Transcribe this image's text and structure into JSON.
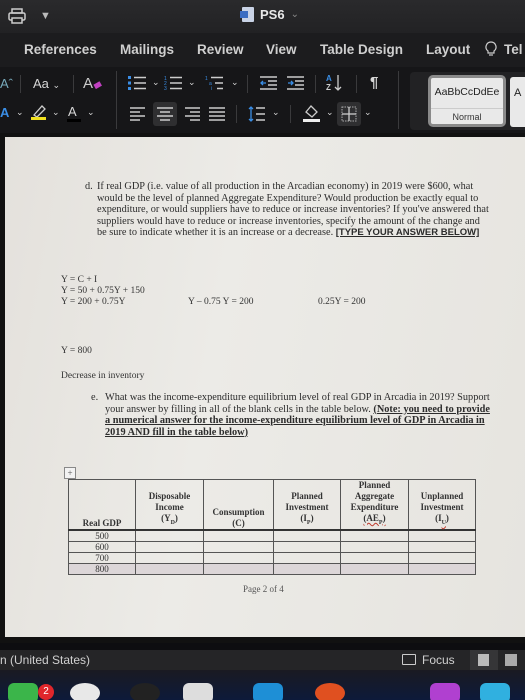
{
  "titlebar": {
    "doc_title": "PS6",
    "icons": [
      "print-icon",
      "customize-quick-access-icon",
      "word-doc-icon",
      "chevron-down-icon"
    ]
  },
  "tabs": [
    {
      "label": "References"
    },
    {
      "label": "Mailings"
    },
    {
      "label": "Review"
    },
    {
      "label": "View"
    },
    {
      "label": "Table Design"
    },
    {
      "label": "Layout"
    },
    {
      "label": "Tel"
    }
  ],
  "ribbon": {
    "change_case": "Aa",
    "font_color_letter": "A",
    "styles": {
      "sample": "AaBbCcDdEe",
      "selected": "Normal",
      "next_sample": "A"
    },
    "highlight_color": "#f0e020",
    "clear_format_color": "#c040c0",
    "accent_blue": "#3a8ee6"
  },
  "document": {
    "question_d": {
      "label": "d.",
      "text": "If real GDP (i.e. value of all production in the Arcadian economy) in 2019 were $600, what would be the level of planned Aggregate Expenditure? Would production be exactly equal to expenditure, or would suppliers have to reduce or increase inventories? If you've answered that suppliers would have to reduce or increase inventories, specify the amount of the change and be sure to indicate whether it is an increase or a decrease. ",
      "instruction": "[TYPE YOUR ANSWER BELOW]"
    },
    "answer": {
      "eq1": "Y = C + I",
      "eq2": "Y = 50 + 0.75Y + 150",
      "eq3": "Y = 200 + 0.75Y",
      "eq4": "Y – 0.75 Y = 200",
      "eq5": "0.25Y = 200",
      "result": "Y = 800",
      "conclusion": "Decrease in inventory"
    },
    "question_e": {
      "label": "e.",
      "text": "What was the income-expenditure equilibrium level of real GDP in Arcadia in 2019? Support your answer by filling in all of the blank cells in the table below. ",
      "note": "(Note: you need to provide a numerical answer for the income-expenditure equilibrium level of GDP in Arcadia in 2019 AND fill in the table below)"
    },
    "table": {
      "headers": [
        {
          "line1": "",
          "line2": "",
          "line3": "Real GDP",
          "line4": ""
        },
        {
          "line1": "Disposable",
          "line2": "Income",
          "line3": "(Y",
          "sub": "D",
          "close": ")"
        },
        {
          "line1": "",
          "line2": "Consumption",
          "line3": "(C)"
        },
        {
          "line1": "Planned",
          "line2": "Investment",
          "line3": "(I",
          "sub": "P",
          "close": ")"
        },
        {
          "line0": "Planned",
          "line1": "Aggregate",
          "line2": "Expenditure",
          "line3": "(AE",
          "sub": "P",
          "close": ")"
        },
        {
          "line1": "Unplanned",
          "line2": "Investment",
          "line3": "(I",
          "sub": "U",
          "close": ")"
        }
      ],
      "rows": [
        {
          "gdp": "500",
          "yd": "",
          "c": "",
          "ip": "",
          "aep": "",
          "iu": ""
        },
        {
          "gdp": "600",
          "yd": "",
          "c": "",
          "ip": "",
          "aep": "",
          "iu": ""
        },
        {
          "gdp": "700",
          "yd": "",
          "c": "",
          "ip": "",
          "aep": "",
          "iu": ""
        },
        {
          "gdp": "800",
          "yd": "",
          "c": "",
          "ip": "",
          "aep": "",
          "iu": ""
        }
      ]
    },
    "page_number": "Page 2 of 4"
  },
  "statusbar": {
    "language": "n (United States)",
    "focus_label": "Focus"
  },
  "dock": {
    "badge_count": "2"
  }
}
